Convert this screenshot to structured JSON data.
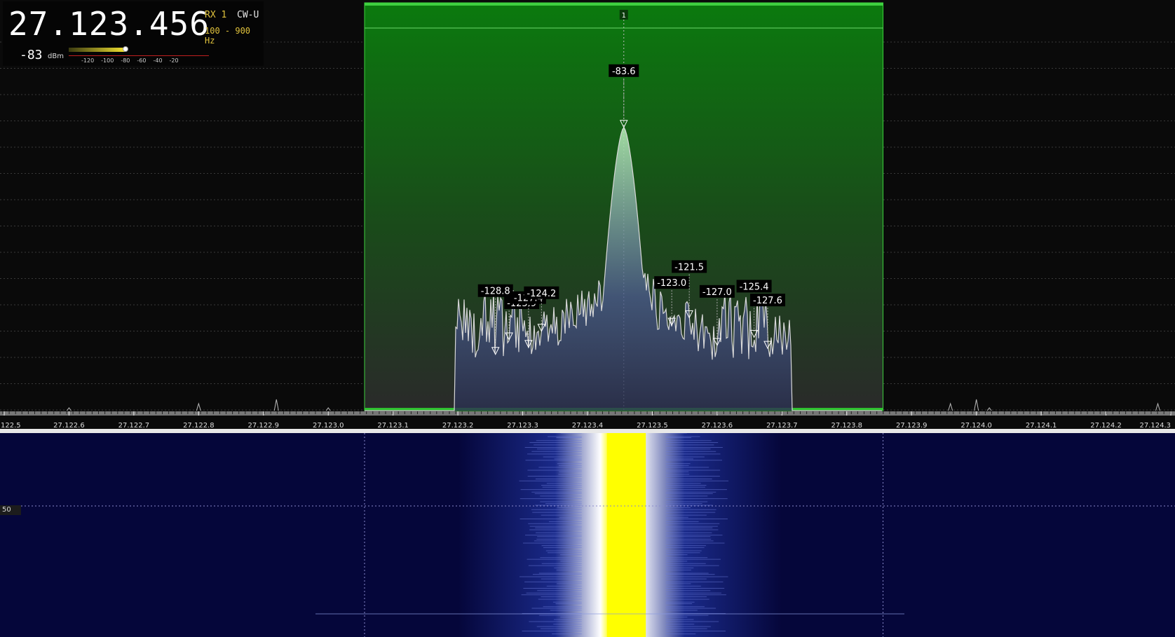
{
  "header": {
    "frequency": "27.123.456",
    "rx": "RX 1",
    "mode": "CW-U",
    "bandwidth": "100 - 900 Hz",
    "signal_level": "-83",
    "signal_unit": "dBm",
    "meter_ticks": [
      "-120",
      "-100",
      "-80",
      "-60",
      "-40",
      "-20"
    ],
    "meter_fill": 0.3
  },
  "colors": {
    "passband": "#0f6a12",
    "passband_border": "#3dd03d",
    "trace": "#d8d8d8",
    "waterfall_bg": "#05063a",
    "waterfall_hot": "#ffff00"
  },
  "filter": {
    "marker_label": "1",
    "low_mhz": 27.123056,
    "high_mhz": 27.123856,
    "center_mhz": 27.123456
  },
  "axis": {
    "tick_labels": [
      "122.5",
      "27.122.6",
      "27.122.7",
      "27.122.8",
      "27.122.9",
      "27.123.0",
      "27.123.1",
      "27.123.2",
      "27.123.3",
      "27.123.4",
      "27.123.5",
      "27.123.6",
      "27.123.7",
      "27.123.8",
      "27.123.9",
      "27.124.0",
      "27.124.1",
      "27.124.2",
      "27.124.3"
    ],
    "ticks_mhz": [
      27.1225,
      27.1226,
      27.1227,
      27.1228,
      27.1229,
      27.123,
      27.1231,
      27.1232,
      27.1233,
      27.1234,
      27.1235,
      27.1236,
      27.1237,
      27.1238,
      27.1239,
      27.124,
      27.1241,
      27.1242,
      27.1243
    ]
  },
  "peaks": [
    {
      "label": "-83.6",
      "mhz": 27.123456,
      "db": -83.6
    },
    {
      "label": "-128.8",
      "mhz": 27.123258,
      "db": -128.8
    },
    {
      "label": "-125.9",
      "mhz": 27.123279,
      "db": -125.9
    },
    {
      "label": "-127.4",
      "mhz": 27.123309,
      "db": -127.4
    },
    {
      "label": "-124.2",
      "mhz": 27.123329,
      "db": -124.2
    },
    {
      "label": "-123.0",
      "mhz": 27.12353,
      "db": -123.0
    },
    {
      "label": "-121.5",
      "mhz": 27.123557,
      "db": -121.5
    },
    {
      "label": "-127.0",
      "mhz": 27.1236,
      "db": -127.0
    },
    {
      "label": "-125.4",
      "mhz": 27.123657,
      "db": -125.4
    },
    {
      "label": "-127.6",
      "mhz": 27.123678,
      "db": -127.6
    }
  ],
  "waterfall": {
    "row_label": "50"
  }
}
